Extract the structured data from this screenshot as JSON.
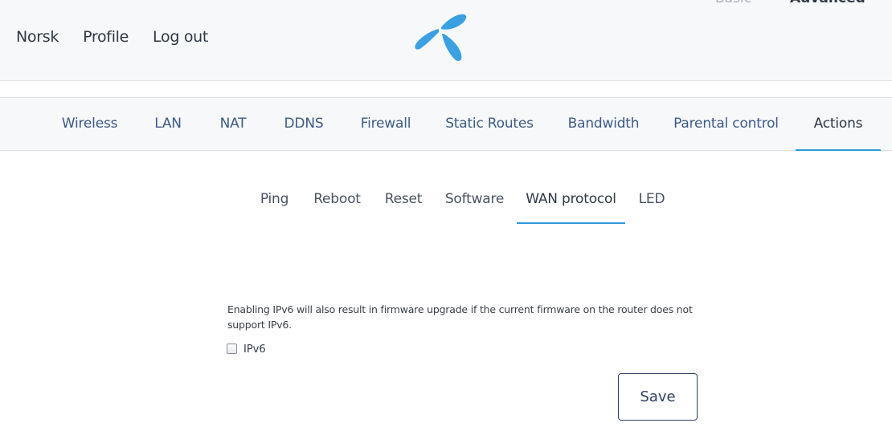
{
  "header": {
    "links": [
      "Norsk",
      "Profile",
      "Log out"
    ],
    "logo_icon": "telenor-logo-icon",
    "mode": {
      "basic": "Basic",
      "advanced": "Advanced"
    }
  },
  "main_nav": {
    "tabs": [
      "Wireless",
      "LAN",
      "NAT",
      "DDNS",
      "Firewall",
      "Static Routes",
      "Bandwidth",
      "Parental control",
      "Actions"
    ],
    "active": "Actions"
  },
  "sub_nav": {
    "tabs": [
      "Ping",
      "Reboot",
      "Reset",
      "Software",
      "WAN protocol",
      "LED"
    ],
    "active": "WAN protocol"
  },
  "wan_protocol": {
    "notice": "Enabling IPv6 will also result in firmware upgrade if the current firmware on the router does not support IPv6.",
    "ipv6_label": "IPv6",
    "ipv6_checked": false,
    "save_label": "Save"
  },
  "colors": {
    "accent": "#2d9bd9",
    "nav_text": "#3d5a8a",
    "button_border": "#2c3e63",
    "header_bg": "#f7f8f9"
  }
}
